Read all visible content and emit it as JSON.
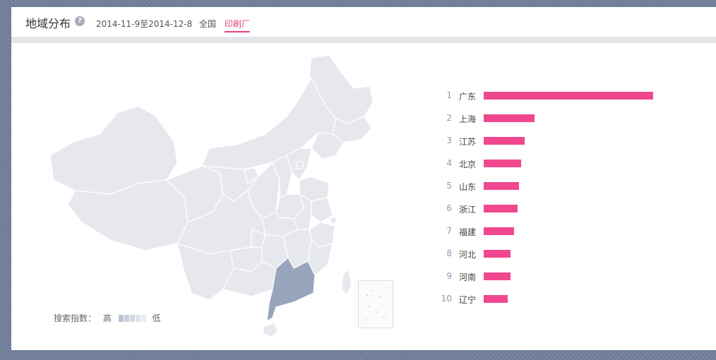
{
  "header": {
    "title": "地域分布",
    "help_icon": "question-icon",
    "date_range": "2014-11-9至2014-12-8",
    "tabs": [
      {
        "label": "全国",
        "active": false
      },
      {
        "label": "印刷厂",
        "active": true
      }
    ]
  },
  "map": {
    "highlight_region": "广东",
    "base_color": "#e6e8ee",
    "highlight_color": "#98a5bd",
    "legend": {
      "label": "搜索指数：",
      "high": "高",
      "low": "低"
    }
  },
  "ranking": {
    "bar_color": "#f0478e",
    "items": [
      {
        "rank": "1",
        "name": "广东",
        "value": 100
      },
      {
        "rank": "2",
        "name": "上海",
        "value": 30
      },
      {
        "rank": "3",
        "name": "江苏",
        "value": 24
      },
      {
        "rank": "4",
        "name": "北京",
        "value": 22
      },
      {
        "rank": "5",
        "name": "山东",
        "value": 21
      },
      {
        "rank": "6",
        "name": "浙江",
        "value": 20
      },
      {
        "rank": "7",
        "name": "福建",
        "value": 18
      },
      {
        "rank": "8",
        "name": "河北",
        "value": 16
      },
      {
        "rank": "9",
        "name": "河南",
        "value": 16
      },
      {
        "rank": "10",
        "name": "辽宁",
        "value": 14
      }
    ]
  }
}
